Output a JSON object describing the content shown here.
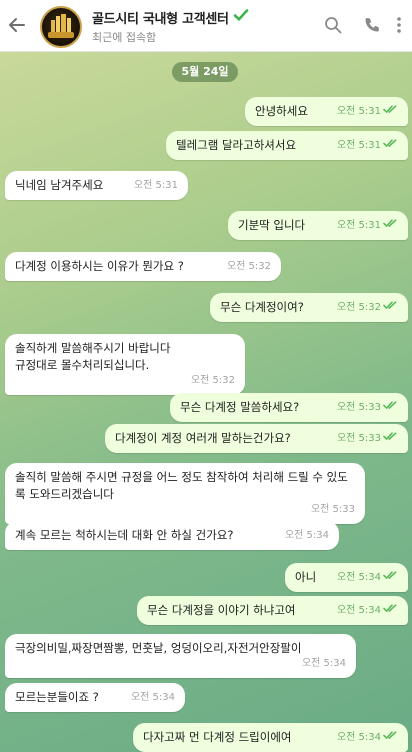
{
  "header": {
    "title": "골드시티 국내형 고객센터",
    "status": "최근에 접속함",
    "avatar_text": "GOLD CITY"
  },
  "chat": {
    "date": "5월 24일",
    "messages": [
      {
        "dir": "out",
        "text": "안녕하세요",
        "time": "오전 5:31",
        "read": true
      },
      {
        "dir": "out",
        "text": "텔레그램 달라고하셔서요",
        "time": "오전 5:31",
        "read": true
      },
      {
        "dir": "in",
        "text": "닉네임 남겨주세요",
        "time": "오전 5:31"
      },
      {
        "dir": "out",
        "text": "기분딱 입니다",
        "time": "오전 5:31",
        "read": true
      },
      {
        "dir": "in",
        "text": "다계정 이용하시는 이유가 뭔가요 ?",
        "time": "오전 5:32"
      },
      {
        "dir": "out",
        "text": "무슨 다계정이여?",
        "time": "오전 5:32",
        "read": true
      },
      {
        "dir": "in",
        "text": "솔직하게 말씀해주시기 바랍니다\n규정대로 몰수처리되십니다.",
        "time": "오전 5:32"
      },
      {
        "dir": "out",
        "text": "무슨 다계정 말씀하세요?",
        "time": "오전 5:33",
        "read": true
      },
      {
        "dir": "out",
        "text": "다계정이 계정 여러개 말하는건가요?",
        "time": "오전 5:33",
        "read": true
      },
      {
        "dir": "in",
        "text": "솔직히 말씀해 주시면 규정을 어느 정도 참작하여 처리해 드릴 수 있도록 도와드리겠습니다",
        "time": "오전 5:33"
      },
      {
        "dir": "in",
        "text": "계속 모르는 척하시는데 대화 안 하실 건가요?",
        "time": "오전 5:34"
      },
      {
        "dir": "out",
        "text": "아니",
        "time": "오전 5:34",
        "read": true
      },
      {
        "dir": "out",
        "text": "무슨 다계정을 이야기 하냐고여",
        "time": "오전 5:34",
        "read": true
      },
      {
        "dir": "in",
        "text": "극장의비밀,짜장면짬뽕, 먼훗날, 엉덩이오리,자전거안장팔이",
        "time": "오전 5:34"
      },
      {
        "dir": "in",
        "text": "모르는분들이죠 ?",
        "time": "오전 5:34"
      },
      {
        "dir": "out",
        "text": "다자고짜 먼 다계정 드립이에여",
        "time": "오전 5:34",
        "read": true
      }
    ]
  }
}
